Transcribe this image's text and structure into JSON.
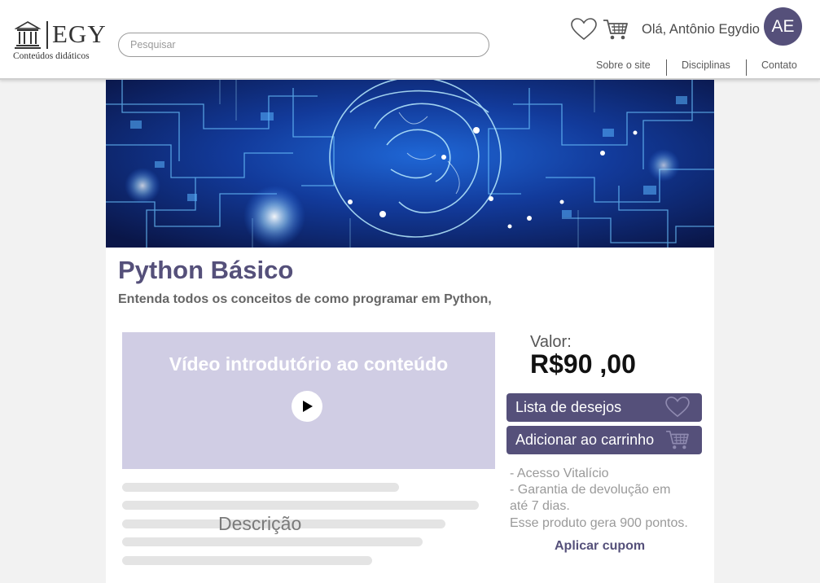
{
  "header": {
    "logo_text": "EGY",
    "logo_subtitle": "Conteúdos didáticos",
    "search_placeholder": "Pesquisar",
    "greeting": "Olá, Antônio Egydio",
    "avatar_initials": "AE",
    "nav": [
      {
        "label": "Sobre o site"
      },
      {
        "label": "Disciplinas"
      },
      {
        "label": "Contato"
      }
    ],
    "icons": [
      "heart-icon",
      "cart-icon",
      "temple-icon"
    ]
  },
  "course": {
    "title": "Python Básico",
    "subtitle": "Entenda todos os conceitos de como programar em Python,",
    "video_title": "Vídeo introdutório ao conteúdo",
    "description_label": "Descrição",
    "price_label": "Valor:",
    "price": "R$90 ,00",
    "wishlist_button": "Lista de desejos",
    "cart_button": "Adicionar ao carrinho",
    "benefits": [
      "- Acesso Vitalício",
      "- Garantia de devolução em",
      "até 7 dias."
    ],
    "points": "Esse produto gera 900 pontos.",
    "coupon": "Aplicar cupom"
  },
  "colors": {
    "accent": "#55507a",
    "video_placeholder": "#d0cde4",
    "background": "#f2f2f2"
  }
}
